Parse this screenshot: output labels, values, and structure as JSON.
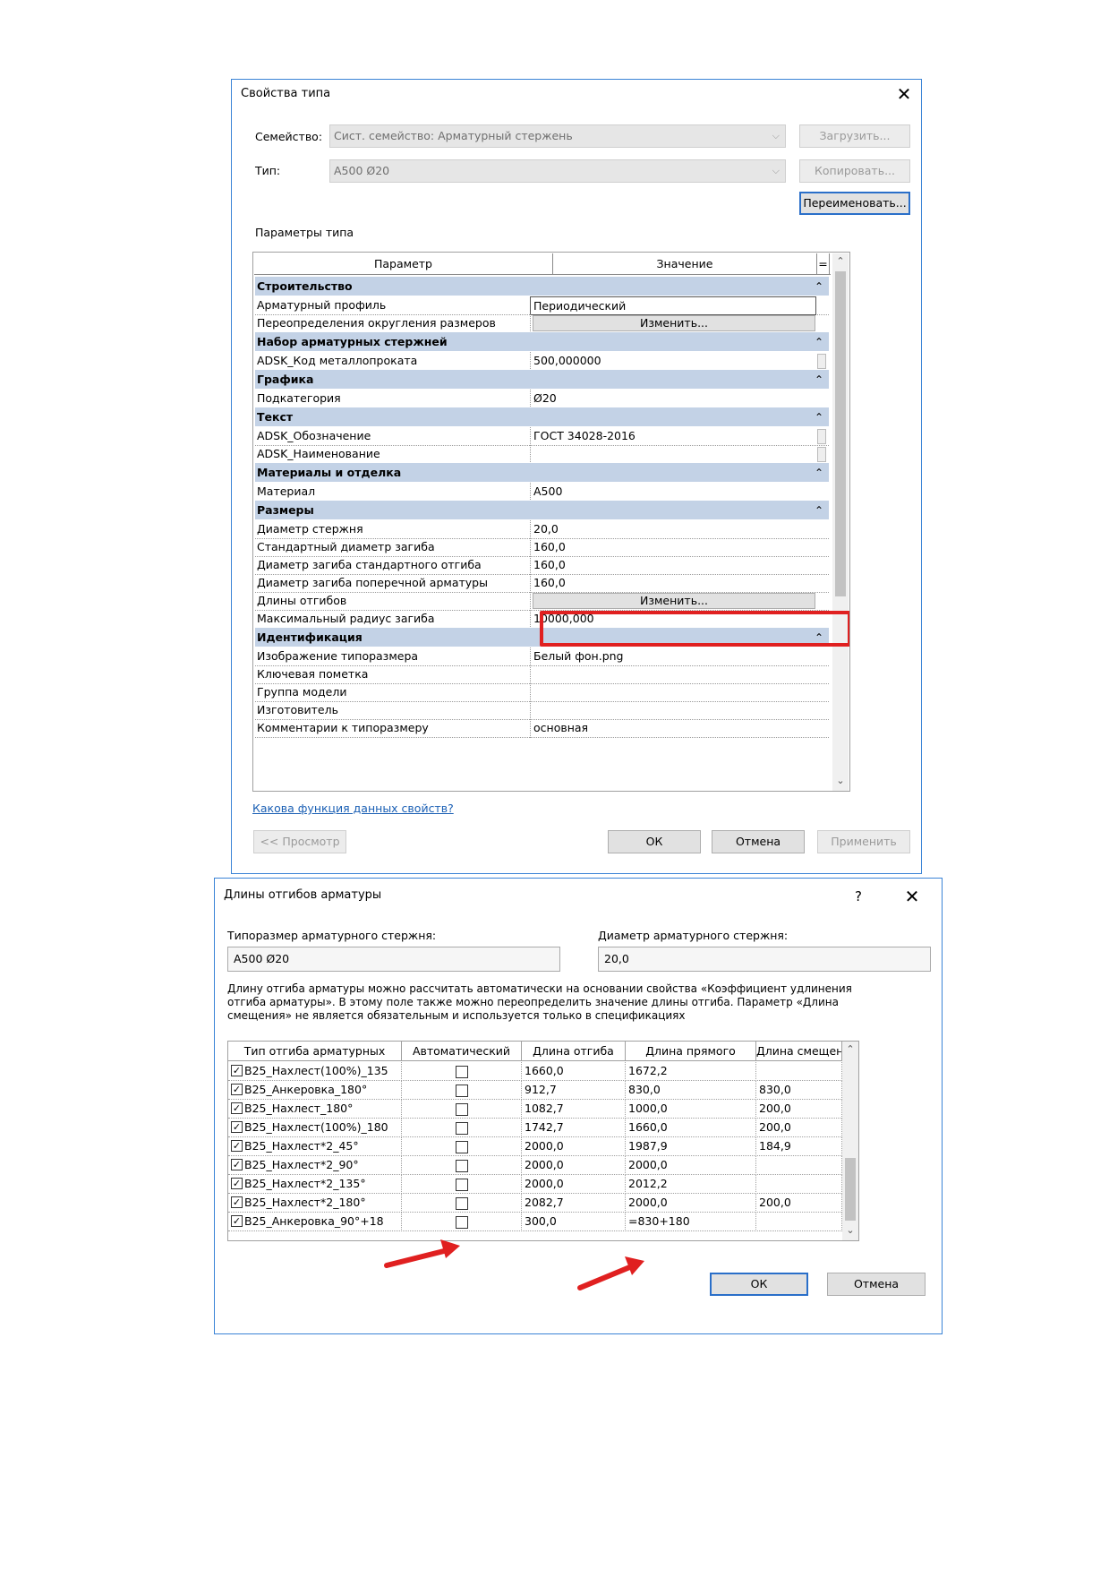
{
  "type_dialog": {
    "title": "Свойства типа",
    "family_label": "Семейство:",
    "family_value": "Сист. семейство: Арматурный стержень",
    "type_label": "Тип:",
    "type_value": "А500 Ø20",
    "load_button": "Загрузить...",
    "copy_button": "Копировать...",
    "rename_button": "Переименовать...",
    "params_label": "Параметры типа",
    "col_param": "Параметр",
    "col_value": "Значение",
    "col_eq": "=",
    "groups": [
      {
        "name": "Строительство",
        "rows": [
          {
            "param": "Арматурный профиль",
            "value": "Периодический",
            "kind": "boxed"
          },
          {
            "param": "Переопределения округления размеров",
            "value": "Изменить...",
            "kind": "button"
          }
        ]
      },
      {
        "name": "Набор арматурных стержней",
        "rows": [
          {
            "param": "ADSK_Код металлопроката",
            "value": "500,000000",
            "kind": "tail"
          }
        ]
      },
      {
        "name": "Графика",
        "rows": [
          {
            "param": "Подкатегория",
            "value": "Ø20",
            "kind": "text"
          }
        ]
      },
      {
        "name": "Текст",
        "rows": [
          {
            "param": "ADSK_Обозначение",
            "value": "ГОСТ 34028-2016",
            "kind": "tail"
          },
          {
            "param": "ADSK_Наименование",
            "value": "",
            "kind": "tail"
          }
        ]
      },
      {
        "name": "Материалы и отделка",
        "rows": [
          {
            "param": "Материал",
            "value": "А500",
            "kind": "text"
          }
        ]
      },
      {
        "name": "Размеры",
        "rows": [
          {
            "param": "Диаметр стержня",
            "value": "20,0",
            "kind": "text"
          },
          {
            "param": "Стандартный диаметр загиба",
            "value": "160,0",
            "kind": "text"
          },
          {
            "param": "Диаметр загиба стандартного отгиба",
            "value": "160,0",
            "kind": "text"
          },
          {
            "param": "Диаметр загиба поперечной арматуры",
            "value": "160,0",
            "kind": "text"
          },
          {
            "param": "Длины отгибов",
            "value": "Изменить...",
            "kind": "button"
          },
          {
            "param": "Максимальный радиус загиба",
            "value": "10000,000",
            "kind": "text"
          }
        ]
      },
      {
        "name": "Идентификация",
        "rows": [
          {
            "param": "Изображение типоразмера",
            "value": "Белый фон.png",
            "kind": "text"
          },
          {
            "param": "Ключевая пометка",
            "value": "",
            "kind": "text"
          },
          {
            "param": "Группа модели",
            "value": "",
            "kind": "text"
          },
          {
            "param": "Изготовитель",
            "value": "",
            "kind": "text"
          },
          {
            "param": "Комментарии к типоразмеру",
            "value": "основная",
            "kind": "text"
          }
        ]
      }
    ],
    "help_link": "Какова функция данных свойств?",
    "preview_button": "<< Просмотр",
    "ok_button": "ОК",
    "cancel_button": "Отмена",
    "apply_button": "Применить"
  },
  "bend_dialog": {
    "title": "Длины отгибов арматуры",
    "help": "?",
    "bar_type_label": "Типоразмер арматурного стержня:",
    "bar_type_value": "А500 Ø20",
    "diameter_label": "Диаметр арматурного стержня:",
    "diameter_value": "20,0",
    "note": "Длину отгиба арматуры можно рассчитать автоматически на основании свойства «Коэффициент удлинения отгиба арматуры». В этому поле также можно переопределить значение длины отгиба. Параметр «Длина смещения» не является обязательным и используется только в спецификациях",
    "columns": [
      "Тип отгиба арматурных",
      "Автоматический",
      "Длина отгиба",
      "Длина прямого",
      "Длина смещения"
    ],
    "rows": [
      {
        "name": "B25_Нахлест(100%)_135",
        "checked": true,
        "auto": false,
        "bend": "1660,0",
        "straight": "1672,2",
        "offset": ""
      },
      {
        "name": "B25_Анкеровка_180°",
        "checked": true,
        "auto": false,
        "bend": "912,7",
        "straight": "830,0",
        "offset": "830,0"
      },
      {
        "name": "B25_Нахлест_180°",
        "checked": true,
        "auto": false,
        "bend": "1082,7",
        "straight": "1000,0",
        "offset": "200,0"
      },
      {
        "name": "B25_Нахлест(100%)_180",
        "checked": true,
        "auto": false,
        "bend": "1742,7",
        "straight": "1660,0",
        "offset": "200,0"
      },
      {
        "name": "B25_Нахлест*2_45°",
        "checked": true,
        "auto": false,
        "bend": "2000,0",
        "straight": "1987,9",
        "offset": "184,9"
      },
      {
        "name": "B25_Нахлест*2_90°",
        "checked": true,
        "auto": false,
        "bend": "2000,0",
        "straight": "2000,0",
        "offset": ""
      },
      {
        "name": "B25_Нахлест*2_135°",
        "checked": true,
        "auto": false,
        "bend": "2000,0",
        "straight": "2012,2",
        "offset": ""
      },
      {
        "name": "B25_Нахлест*2_180°",
        "checked": true,
        "auto": false,
        "bend": "2082,7",
        "straight": "2000,0",
        "offset": "200,0"
      },
      {
        "name": "B25_Анкеровка_90°+18",
        "checked": true,
        "auto": false,
        "bend": "300,0",
        "straight": "=830+180",
        "offset": ""
      }
    ],
    "ok_button": "ОК",
    "cancel_button": "Отмена"
  },
  "colors": {
    "highlight": "#e02020",
    "arrow": "#e02020",
    "group_bg": "#c3d2e6",
    "accent": "#2a6fc9"
  }
}
